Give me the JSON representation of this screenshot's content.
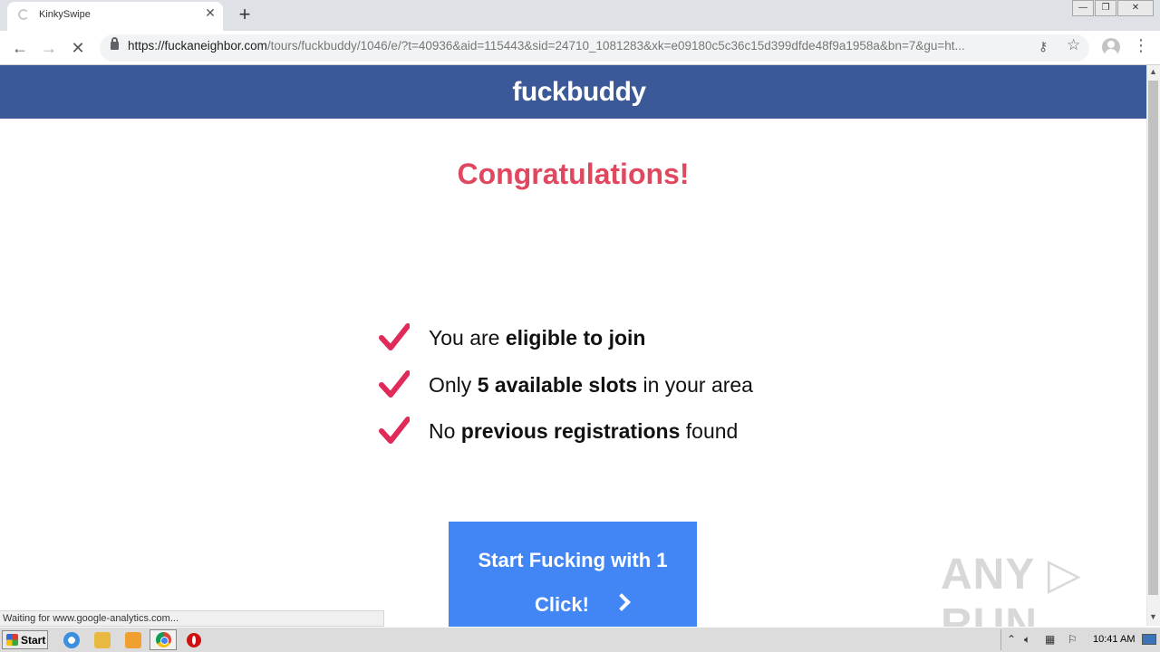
{
  "browser": {
    "tab_title": "KinkySwipe",
    "tab_close": "✕",
    "new_tab": "+",
    "url_host": "https://fuckaneighbor.com",
    "url_path": "/tours/fuckbuddy/1046/e/?t=40936&aid=115443&sid=24710_1081283&xk=e09180c5c36c15d399dfde48f9a1958a&bn=7&gu=ht...",
    "window_controls": {
      "minimize": "—",
      "maximize": "❐",
      "close": "✕"
    },
    "nav": {
      "back": "←",
      "forward": "→",
      "stop": "✕"
    },
    "icons": {
      "key": "key-icon",
      "star": "star-icon",
      "profile": "profile-icon",
      "menu": "menu-icon"
    }
  },
  "page": {
    "logo": "fuckbuddy",
    "congrats": "Congratulations!",
    "checklist": [
      {
        "pre": "You are ",
        "bold": "eligible to join",
        "post": ""
      },
      {
        "pre": "Only ",
        "bold": "5 available slots",
        "post": " in your area"
      },
      {
        "pre": "No ",
        "bold": "previous registrations",
        "post": " found"
      }
    ],
    "cta": {
      "line1": "Start Fucking with 1",
      "line2": "Click!"
    },
    "colors": {
      "header": "#3b5998",
      "accent": "#e0485f",
      "cta": "#4285f4"
    }
  },
  "watermark": "ANY ▷ RUN",
  "status": "Waiting for www.google-analytics.com...",
  "taskbar": {
    "start": "Start",
    "clock": "10:41 AM",
    "tray_icons": [
      "chevron-up-icon",
      "volume-icon",
      "network-icon",
      "flag-icon"
    ]
  }
}
